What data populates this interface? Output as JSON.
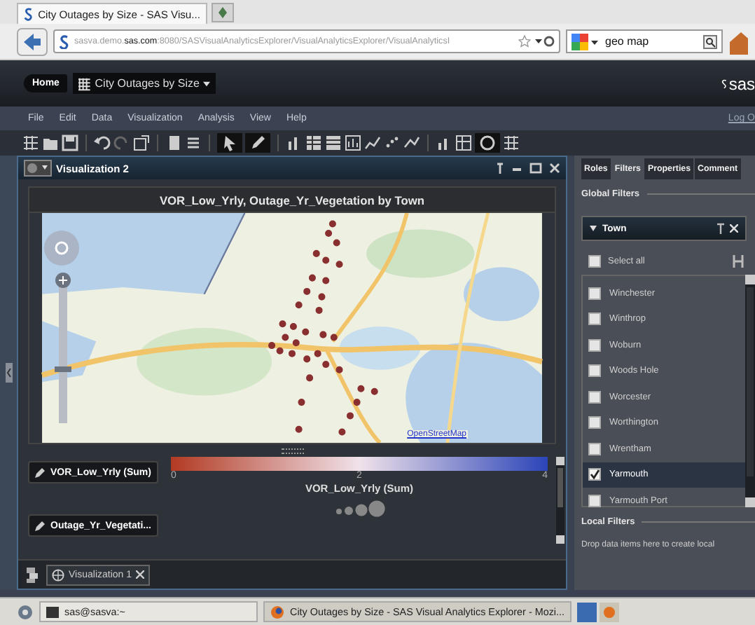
{
  "browser": {
    "tabs": [
      {
        "title": "City Outages by Size - SAS Visu...",
        "selected": true
      }
    ],
    "url": "sasva.demo.**sas.com**:8080/SASVisualAnalyticsExplorer/VisualAnalyticsExplorer/VisualAnalyticsI",
    "search": {
      "value": "geo map"
    }
  },
  "app": {
    "home": "Home",
    "report": "City Outages by Size",
    "logo": "sas",
    "logout": "Log O"
  },
  "menu": [
    "File",
    "Edit",
    "Data",
    "Visualization",
    "Analysis",
    "View",
    "Help"
  ],
  "visualization": {
    "title": "Visualization 2",
    "zoom": {
      "level": 0.38
    },
    "chart_title": "VOR_Low_Yrly, Outage_Yr_Vegetation by Town",
    "map_credit": "OpenStreetMap",
    "roles": [
      {
        "label": "VOR_Low_Yrly (Sum)"
      },
      {
        "label": "Outage_Yr_Vegetati..."
      }
    ],
    "color_legend": {
      "title": "VOR_Low_Yrly (Sum)",
      "ticks": [
        "0",
        "2",
        "4"
      ]
    }
  },
  "bottom_tabs": [
    {
      "label": "Visualization 1",
      "selected": true
    }
  ],
  "panel": {
    "tabs": [
      {
        "label": "Roles",
        "selected": false
      },
      {
        "label": "Filters",
        "selected": true
      },
      {
        "label": "Properties",
        "selected": false
      },
      {
        "label": "Comment",
        "selected": false
      }
    ],
    "global_filters": "Global Filters",
    "filter": {
      "name": "Town",
      "select_all": {
        "label": "Select all",
        "checked": false
      },
      "items": [
        {
          "label": "Winchester",
          "checked": false,
          "selected": false
        },
        {
          "label": "Winthrop",
          "checked": false,
          "selected": false
        },
        {
          "label": "Woburn",
          "checked": false,
          "selected": false
        },
        {
          "label": "Woods Hole",
          "checked": false,
          "selected": false
        },
        {
          "label": "Worcester",
          "checked": false,
          "selected": false
        },
        {
          "label": "Worthington",
          "checked": false,
          "selected": false
        },
        {
          "label": "Wrentham",
          "checked": false,
          "selected": false
        },
        {
          "label": "Yarmouth",
          "checked": true,
          "selected": true
        },
        {
          "label": "Yarmouth Port",
          "checked": false,
          "selected": false
        }
      ]
    },
    "local_filters": "Local Filters",
    "local_hint": "Drop data items here to create local"
  },
  "taskbar": {
    "items": [
      {
        "label": "sas@sasva:~",
        "selected": false
      },
      {
        "label": "City Outages by Size - SAS Visual Analytics Explorer - Mozi...",
        "selected": true
      }
    ]
  }
}
